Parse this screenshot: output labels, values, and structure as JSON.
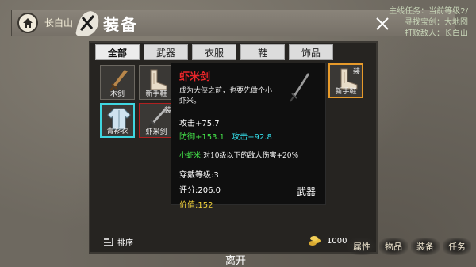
{
  "header": {
    "location": "长白山",
    "title": "装备",
    "status_lines": [
      "主线任务：当前等级2/",
      "寻找宝剑：大地图",
      "打败敌人：长白山"
    ]
  },
  "tabs": [
    {
      "label": "全部",
      "active": true
    },
    {
      "label": "武器",
      "active": false
    },
    {
      "label": "衣服",
      "active": false
    },
    {
      "label": "鞋",
      "active": false
    },
    {
      "label": "饰品",
      "active": false
    }
  ],
  "inventory": [
    {
      "label": "木剑",
      "equipped": ""
    },
    {
      "label": "新手鞋",
      "equipped": ""
    },
    {
      "label": "青衫衣",
      "equipped": ""
    },
    {
      "label": "虾米剑",
      "equipped": "装"
    }
  ],
  "equipped_slot": {
    "label": "新手鞋",
    "equipped": "装"
  },
  "detail": {
    "name": "虾米剑",
    "description": "成为大侠之前，也要先做个小虾米。",
    "attack": "攻击+75.7",
    "defense_bonus": "防御+153.1",
    "attack_bonus": "攻击+92.8",
    "passive_name": "小虾米:",
    "passive_text": "对10级以下的敌人伤害+20%",
    "wear_level": "穿戴等级:3",
    "score": "评分:206.0",
    "price": "价值:152",
    "type": "武器"
  },
  "footer": {
    "sort_label": "排序",
    "coins": "1000",
    "leave_label": "离开",
    "menu": [
      "属性",
      "物品",
      "装备",
      "任务"
    ]
  },
  "colors": {
    "item_name": "#e8262a",
    "bonus_green": "#44e14a",
    "bonus_cyan": "#35e0ec",
    "price_yellow": "#f2d23a"
  }
}
